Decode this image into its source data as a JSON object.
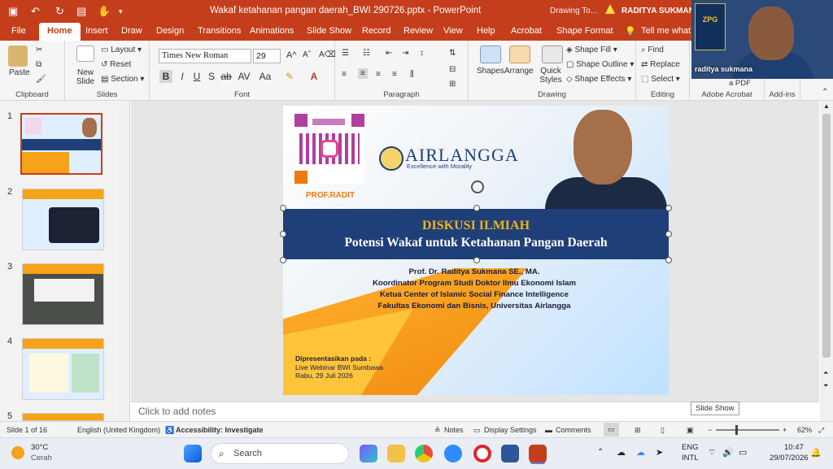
{
  "titlebar": {
    "document_title": "Wakaf ketahanan pangan daerah_BWI 290726.pptx - PowerPoint",
    "drawing_tools": "Drawing To...",
    "user_name": "RADITYA SUKMANA",
    "accent_color": "#c43e1c"
  },
  "tabs": [
    "File",
    "Home",
    "Insert",
    "Draw",
    "Design",
    "Transitions",
    "Animations",
    "Slide Show",
    "Record",
    "Review",
    "View",
    "Help",
    "Acrobat",
    "Shape Format",
    "Tell me what yo"
  ],
  "active_tab": "Home",
  "ribbon": {
    "clipboard": {
      "paste": "Paste",
      "label": "Clipboard"
    },
    "slides": {
      "new_slide": "New Slide",
      "layout": "Layout",
      "reset": "Reset",
      "section": "Section",
      "label": "Slides"
    },
    "font": {
      "name": "Times New Roman",
      "size": "29",
      "label": "Font"
    },
    "paragraph": {
      "label": "Paragraph"
    },
    "drawing": {
      "shapes": "Shapes",
      "arrange": "Arrange",
      "quick_styles": "Quick Styles",
      "shape_fill": "Shape Fill",
      "shape_outline": "Shape Outline",
      "shape_effects": "Shape Effects",
      "label": "Drawing"
    },
    "editing": {
      "find": "Find",
      "replace": "Replace",
      "select": "Select",
      "label": "Editing"
    },
    "adobe": {
      "label": "Adobe Acrobat",
      "pdf": "a PDF"
    },
    "addins": {
      "label": "Add-ins"
    }
  },
  "video": {
    "badge": "ZPG",
    "name": "raditya sukmana"
  },
  "thumbnails": [
    "1",
    "2",
    "3",
    "4",
    "5"
  ],
  "slide": {
    "qr_label": "PROF.RADIT",
    "logo_text": "AIRLANGGA",
    "logo_sub": "Excellence with Morality",
    "title": "DISKUSI ILMIAH",
    "subtitle": "Potensi Wakaf untuk Ketahanan Pangan Daerah",
    "speaker_lines": [
      "Prof. Dr. Raditya Sukmana SE., MA.",
      "Koordinator Program Studi Doktor Ilmu Ekonomi Islam",
      "Ketua Center of Islamic Social Finance Intelligence",
      "Fakultas Ekonomi dan Bisnis, Universitas Airlangga"
    ],
    "presented_label": "Dipresentasikan pada :",
    "presented_event": "Live Webinar BWI Sumbawa",
    "presented_date": "Rabu, 29 Juli 2026"
  },
  "notes_placeholder": "Click to add notes",
  "tooltip": "Slide Show",
  "status": {
    "slide_count": "Slide 1 of 16",
    "language": "English (United Kingdom)",
    "accessibility": "Accessibility: Investigate",
    "notes": "Notes",
    "display_settings": "Display Settings",
    "comments": "Comments",
    "zoom": "62%"
  },
  "taskbar": {
    "weather_temp": "30°C",
    "weather_desc": "Cerah",
    "search": "Search",
    "lang1": "ENG",
    "lang2": "INTL",
    "time": "10:47",
    "date": "29/07/2026"
  }
}
